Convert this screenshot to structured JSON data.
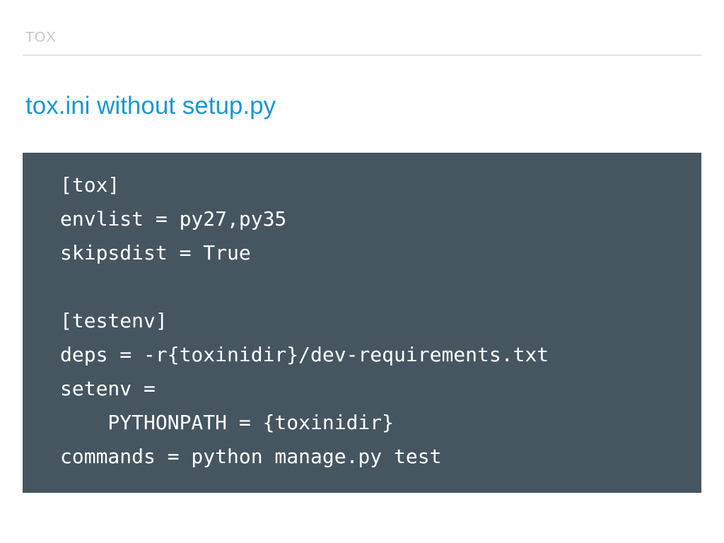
{
  "header": {
    "section_label": "TOX"
  },
  "slide": {
    "title": "tox.ini without setup.py"
  },
  "code": {
    "lines": [
      "[tox]",
      "envlist = py27,py35",
      "skipsdist = True",
      "",
      "[testenv]",
      "deps = -r{toxinidir}/dev-requirements.txt",
      "setenv =",
      "    PYTHONPATH = {toxinidir}",
      "commands = python manage.py test"
    ]
  },
  "colors": {
    "accent": "#1a98d5",
    "code_background": "#455661",
    "code_text": "#ffffff",
    "label": "#c4c9ce",
    "rule": "#e2e5e8"
  }
}
